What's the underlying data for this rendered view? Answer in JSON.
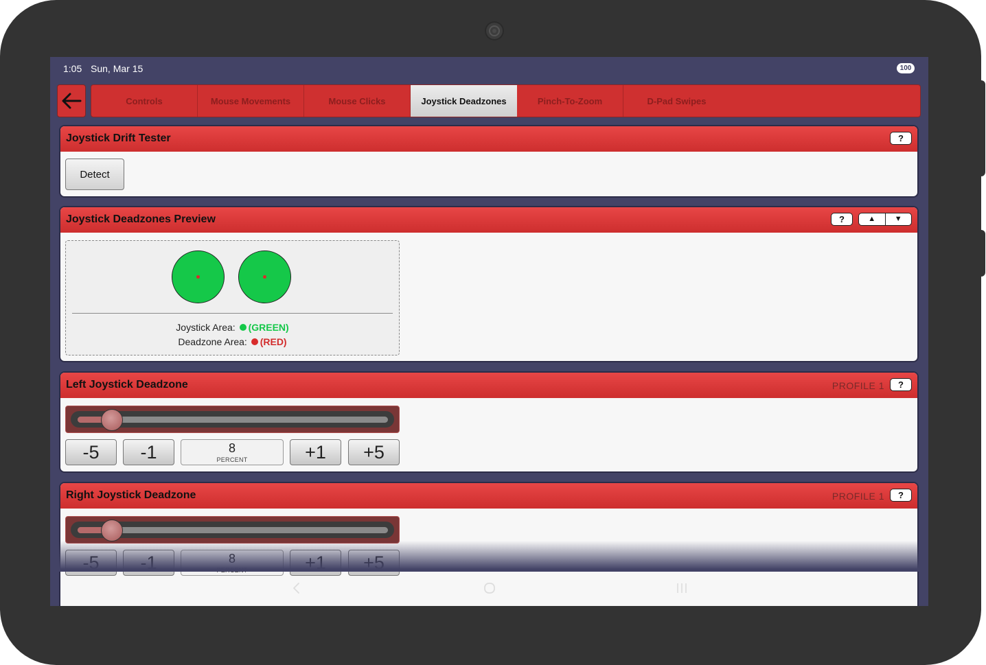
{
  "status": {
    "time": "1:05",
    "date": "Sun, Mar 15",
    "battery": "100"
  },
  "tabs": [
    {
      "label": "Controls"
    },
    {
      "label": "Mouse Movements"
    },
    {
      "label": "Mouse Clicks"
    },
    {
      "label": "Joystick Deadzones",
      "active": true
    },
    {
      "label": "Pinch-To-Zoom"
    },
    {
      "label": "D-Pad Swipes"
    }
  ],
  "drift_tester": {
    "title": "Joystick Drift Tester",
    "help": "?",
    "detect_label": "Detect"
  },
  "preview": {
    "title": "Joystick Deadzones Preview",
    "help": "?",
    "up": "▲",
    "down": "▼",
    "joystick_area_label": "Joystick Area:",
    "joystick_area_color_name": "(GREEN)",
    "deadzone_area_label": "Deadzone Area:",
    "deadzone_area_color_name": "(RED)"
  },
  "left_deadzone": {
    "title": "Left Joystick Deadzone",
    "profile": "PROFILE 1",
    "help": "?",
    "value": "8",
    "unit": "PERCENT",
    "slider_percent": 8,
    "minus5": "-5",
    "minus1": "-1",
    "plus1": "+1",
    "plus5": "+5"
  },
  "right_deadzone": {
    "title": "Right Joystick Deadzone",
    "profile": "PROFILE 1",
    "help": "?",
    "value": "8",
    "unit": "PERCENT",
    "slider_percent": 8,
    "minus5": "-5",
    "minus1": "-1",
    "plus1": "+1",
    "plus5": "+5"
  },
  "colors": {
    "accent": "#d13232",
    "joystick_area": "#15c849",
    "deadzone_area": "#d82c2c",
    "screen_bg": "#434366"
  },
  "icons": {
    "back": "arrow-left-icon",
    "nav_back": "chevron-left-icon",
    "nav_home": "circle-home-icon",
    "nav_recents": "recents-icon"
  }
}
